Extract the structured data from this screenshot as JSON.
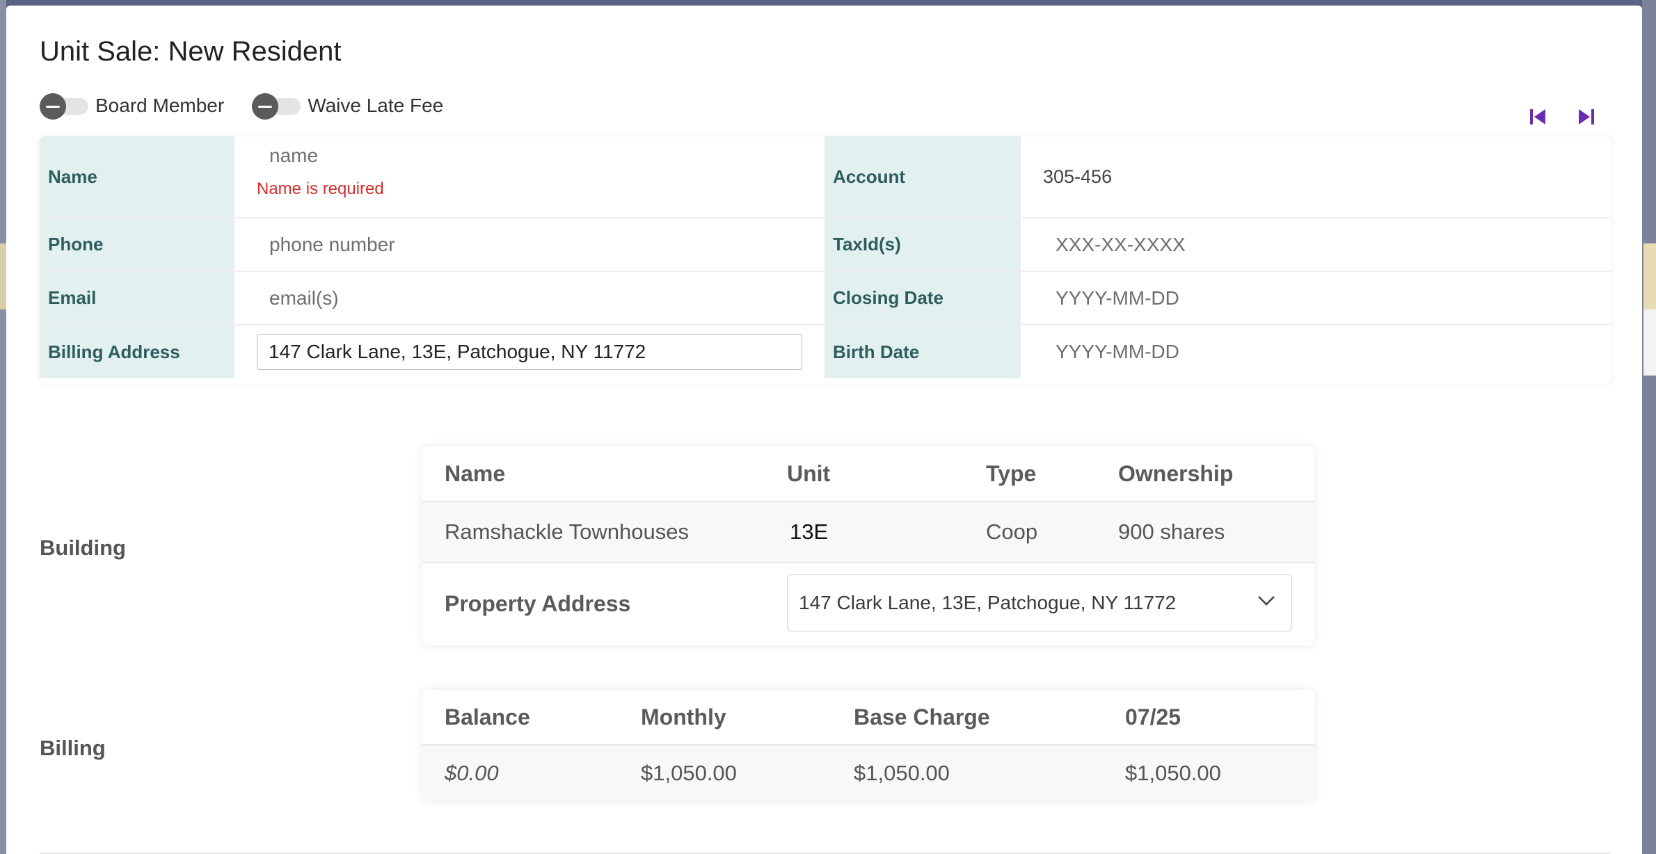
{
  "modal": {
    "title": "Unit Sale: New Resident"
  },
  "toggles": [
    {
      "label": "Board Member",
      "on": false
    },
    {
      "label": "Waive Late Fee",
      "on": false
    }
  ],
  "nav": {
    "first_icon": "skip-first-icon",
    "last_icon": "skip-last-icon",
    "color": "#6a2fb0"
  },
  "form": {
    "name": {
      "label": "Name",
      "placeholder": "name",
      "error": "Name is required"
    },
    "phone": {
      "label": "Phone",
      "placeholder": "phone number"
    },
    "email": {
      "label": "Email",
      "placeholder": "email(s)"
    },
    "billing_address": {
      "label": "Billing Address",
      "value": "147 Clark Lane, 13E, Patchogue, NY 11772"
    },
    "account": {
      "label": "Account",
      "value": "305-456"
    },
    "taxid": {
      "label": "TaxId(s)",
      "placeholder": "XXX-XX-XXXX"
    },
    "closing_date": {
      "label": "Closing Date",
      "placeholder": "YYYY-MM-DD"
    },
    "birth_date": {
      "label": "Birth Date",
      "placeholder": "YYYY-MM-DD"
    }
  },
  "building": {
    "section_label": "Building",
    "headers": {
      "name": "Name",
      "unit": "Unit",
      "type": "Type",
      "ownership": "Ownership"
    },
    "row": {
      "name": "Ramshackle Townhouses",
      "unit": "13E",
      "type": "Coop",
      "ownership": "900 shares"
    },
    "property_address": {
      "label": "Property Address",
      "value": "147 Clark Lane, 13E, Patchogue, NY 11772"
    }
  },
  "billing": {
    "section_label": "Billing",
    "headers": {
      "balance": "Balance",
      "monthly": "Monthly",
      "base_charge": "Base Charge",
      "period": "07/25"
    },
    "row": {
      "balance": "$0.00",
      "monthly": "$1,050.00",
      "base_charge": "$1,050.00",
      "period": "$1,050.00"
    }
  }
}
